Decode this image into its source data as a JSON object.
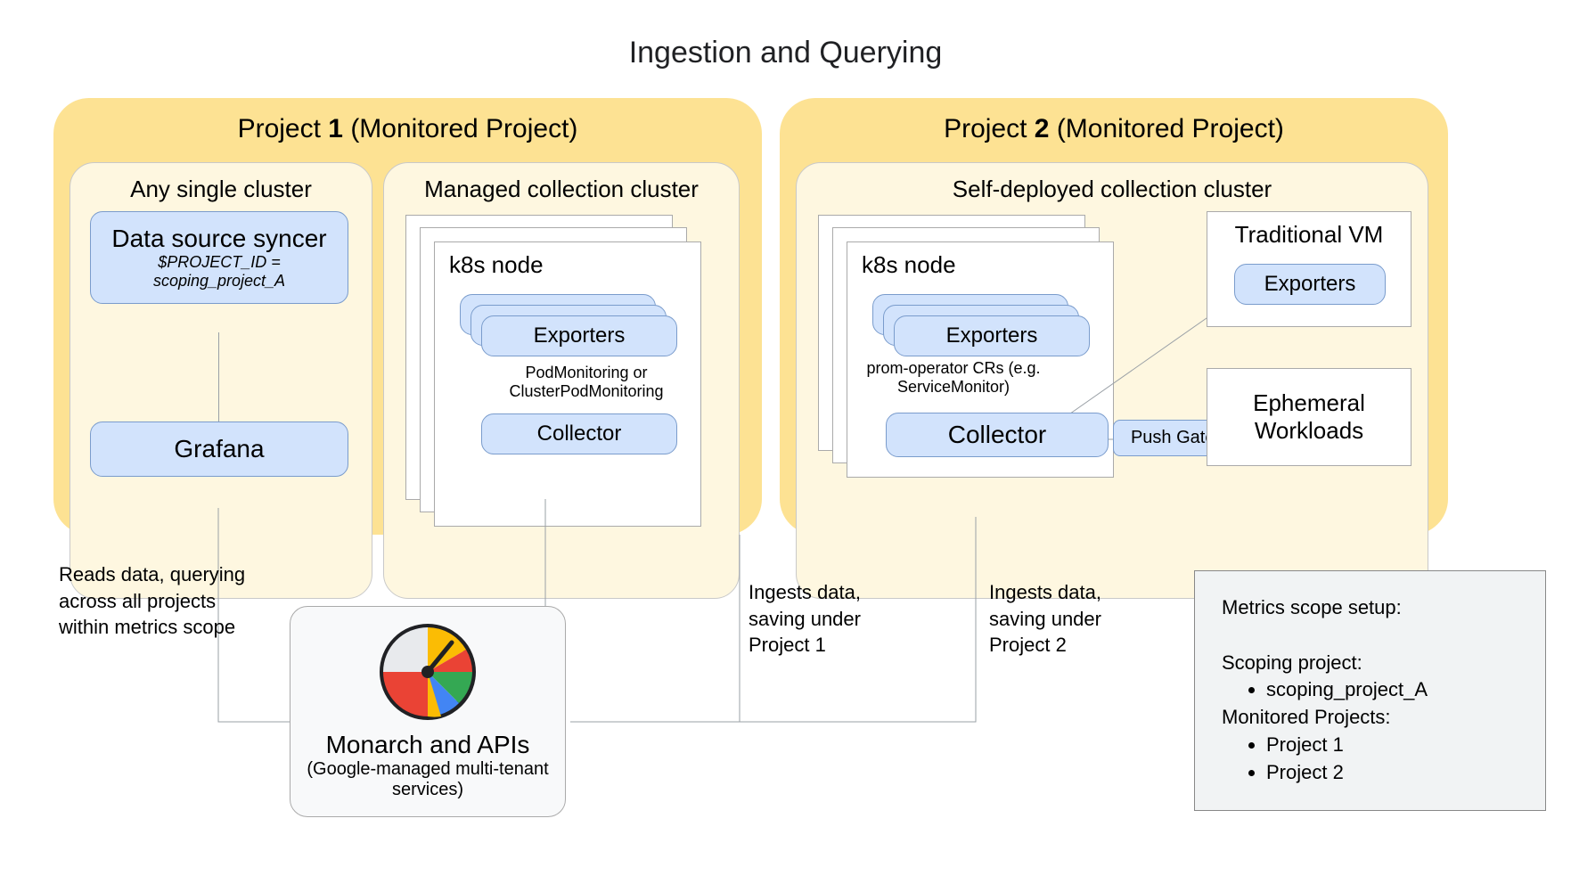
{
  "title": "Ingestion and Querying",
  "project1": {
    "labelPrefix": "Project ",
    "labelBold": "1",
    "labelSuffix": " (Monitored Project)",
    "anyCluster": {
      "label": "Any single cluster",
      "dataSource": {
        "title": "Data source syncer",
        "subtitle": "$PROJECT_ID = scoping_project_A"
      },
      "grafana": "Grafana"
    },
    "managedCluster": {
      "label": "Managed collection cluster",
      "nodeLabel": "k8s node",
      "exporters": "Exporters",
      "note": "PodMonitoring or ClusterPodMonitoring",
      "collector": "Collector"
    }
  },
  "project2": {
    "labelPrefix": "Project ",
    "labelBold": "2",
    "labelSuffix": " (Monitored Project)",
    "selfCluster": {
      "label": "Self-deployed collection cluster",
      "nodeLabel": "k8s node",
      "exporters": "Exporters",
      "note": "prom-operator CRs (e.g. ServiceMonitor)",
      "collector": "Collector",
      "pushGw": "Push Gateway",
      "vmTitle": "Traditional VM",
      "vmExporters": "Exporters",
      "ephemeral": "Ephemeral Workloads"
    }
  },
  "notes": {
    "reads": "Reads data, querying across all projects within metrics scope",
    "ingest1a": "Ingests data,",
    "ingest1b": "saving under",
    "ingest1c": "Project 1",
    "ingest2a": "Ingests data,",
    "ingest2b": "saving under",
    "ingest2c": "Project 2"
  },
  "monarch": {
    "title": "Monarch and APIs",
    "subtitle": "(Google-managed multi-tenant services)"
  },
  "legend": {
    "title": "Metrics scope setup:",
    "scoping": "Scoping project:",
    "scopingProject": "scoping_project_A",
    "monitored": "Monitored Projects:",
    "mp1": "Project 1",
    "mp2": "Project 2"
  }
}
